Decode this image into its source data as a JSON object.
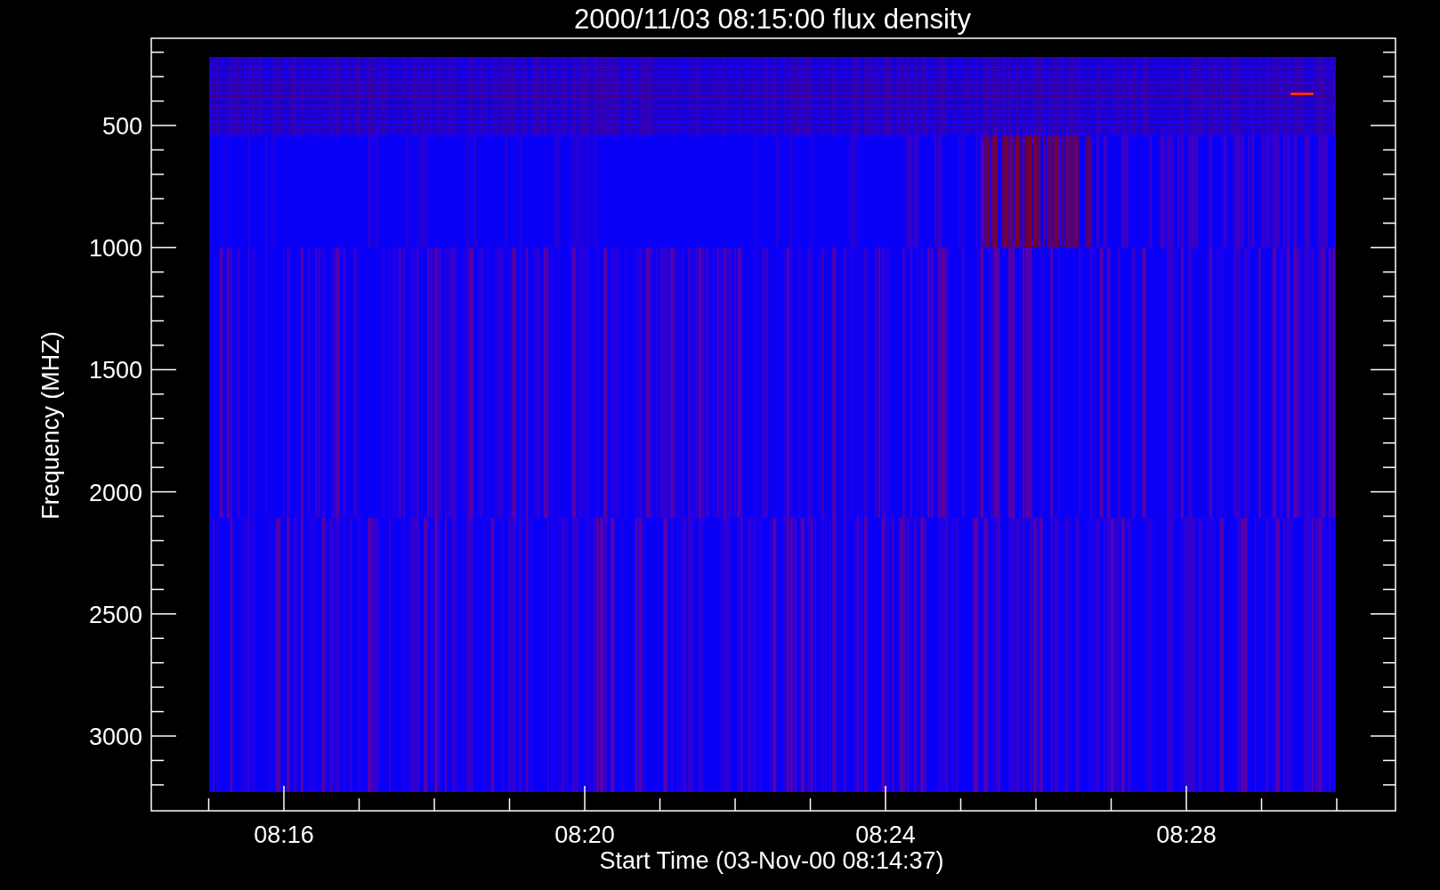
{
  "title": "2000/11/03 08:15:00 flux density",
  "ylabel": "Frequency (MHZ)",
  "xlabel": "Start Time (03-Nov-00 08:14:37)",
  "yticks": [
    "500",
    "1000",
    "1500",
    "2000",
    "2500",
    "3000"
  ],
  "xticks": [
    "08:16",
    "08:20",
    "08:24",
    "08:28"
  ]
}
